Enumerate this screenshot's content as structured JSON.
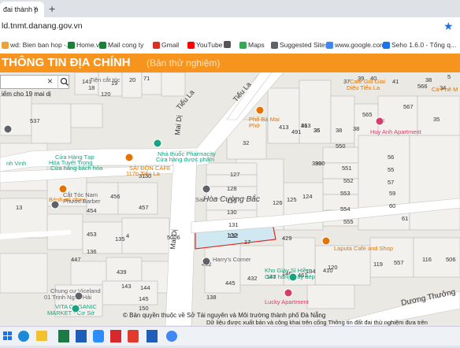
{
  "browser": {
    "tab_title": "đai thành p",
    "new_tab_glyph": "+",
    "close_glyph": "×",
    "address": "ld.tnmt.danang.gov.vn",
    "star_glyph": "★",
    "bookmarks": [
      {
        "label": "wd: Bien ban hop -...",
        "color": "#e8a33d"
      },
      {
        "label": "Home.vn",
        "color": "#1a7f37"
      },
      {
        "label": "Mail cong ty",
        "color": "#1a7f37"
      },
      {
        "label": "Gmail",
        "color": "#d93025"
      },
      {
        "label": "YouTube",
        "color": "#ff0000"
      },
      {
        "label": "",
        "color": "#555555"
      },
      {
        "label": "Maps",
        "color": "#34a853"
      },
      {
        "label": "Suggested Sites",
        "color": "#5f6368"
      },
      {
        "label": "www.google.com",
        "color": "#4285f4"
      },
      {
        "label": "Seho 1.6.0 - Tổng q...",
        "color": "#1a73e8"
      }
    ]
  },
  "header": {
    "title": "THÔNG TIN ĐỊA CHÍNH",
    "subtitle": "(Bản thử nghiệm)",
    "bg_color": "#f7941d"
  },
  "search": {
    "clear_glyph": "×",
    "result_text": "iếm cho 19 mai dị"
  },
  "map": {
    "streets": [
      "Mai Dị",
      "Mai Dị",
      "Tiểu La",
      "Tiểu La",
      "Dương Thưởng"
    ],
    "areas": [
      "Hòa Cường Bắc"
    ],
    "highlight_parcel": "132",
    "pois": [
      {
        "label": "Phố Bà Mai",
        "color": "#e37400"
      },
      {
        "label": "Phở",
        "color": "#e37400"
      },
      {
        "label": "Nhà thuốc Pharmacity",
        "color": "#16a37f"
      },
      {
        "label": "Cửa hàng dược phẩm",
        "color": "#16a37f"
      },
      {
        "label": "SÀI ĐÒN CAFE",
        "color": "#e37400"
      },
      {
        "label": "117b Tiểu La",
        "color": "#e37400"
      },
      {
        "label": "Cửa Hàng Tạp",
        "color": "#16a37f"
      },
      {
        "label": "Hóa Tuyết Trong",
        "color": "#16a37f"
      },
      {
        "label": "Cửa hàng bách hóa",
        "color": "#16a37f"
      },
      {
        "label": "Bánh mì chay",
        "color": "#e37400"
      },
      {
        "label": "Cắt Tóc Nam",
        "color": "#5f6368"
      },
      {
        "label": "Phước Barber",
        "color": "#5f6368"
      },
      {
        "label": "Harry's Corner",
        "color": "#5f6368"
      },
      {
        "label": "Kho Giày Sỉ Hiền",
        "color": "#16a37f"
      },
      {
        "label": "Cửa hàng giày dép",
        "color": "#16a37f"
      },
      {
        "label": "Lucky Apartment",
        "color": "#d23f6c"
      },
      {
        "label": "Huy Anh Apartment",
        "color": "#d23f6c"
      },
      {
        "label": "Laputa Cafe and Shop",
        "color": "#e37400"
      },
      {
        "label": "Chung cư Viceland",
        "color": "#5f6368"
      },
      {
        "label": "01 Trịnh Nghị, Hải",
        "color": "#5f6368"
      },
      {
        "label": "VITA ORGANIC",
        "color": "#16a37f"
      },
      {
        "label": "MARKET - Cơ Sở",
        "color": "#16a37f"
      },
      {
        "label": "Sai",
        "color": "#5f6368"
      },
      {
        "label": "Tiện cắt tóc",
        "color": "#5f6368"
      },
      {
        "label": "Diệu Tiểu La",
        "color": "#e37400"
      },
      {
        "label": "Cà Phê M",
        "color": "#e37400"
      },
      {
        "label": "Cafe Gió Giai",
        "color": "#e37400"
      },
      {
        "label": "nh Vinh",
        "color": "#16a37f"
      }
    ],
    "parcels": [
      "141",
      "19",
      "20",
      "71",
      "18",
      "537",
      "120",
      "491",
      "413",
      "36",
      "35",
      "38",
      "38",
      "565",
      "567",
      "58",
      "32",
      "390",
      "413",
      "36",
      "390",
      "550",
      "551",
      "552",
      "553",
      "554",
      "555",
      "56",
      "55",
      "57",
      "59",
      "60",
      "61",
      "127",
      "128",
      "129",
      "130",
      "131",
      "132",
      "126",
      "125",
      "124",
      "456",
      "457",
      "31",
      "30",
      "13",
      "454",
      "453",
      "135",
      "447",
      "136",
      "439",
      "412",
      "445",
      "432",
      "147",
      "146",
      "461",
      "410",
      "120",
      "119",
      "557",
      "116",
      "506",
      "138",
      "143",
      "144",
      "145",
      "150",
      "5006",
      "35",
      "34",
      "38",
      "37",
      "39",
      "40",
      "41",
      "566",
      "5",
      "4",
      "17",
      "429",
      "134",
      "460"
    ],
    "copyright": "© Bản quyền thuộc về Sở Tài nguyên và Môi trường thành phố Đà Nẵng",
    "disclaimer": "Dữ liệu được xuất bản và công khai trên cổng Thông tin đất đai thử nghiệm đưa trên"
  }
}
